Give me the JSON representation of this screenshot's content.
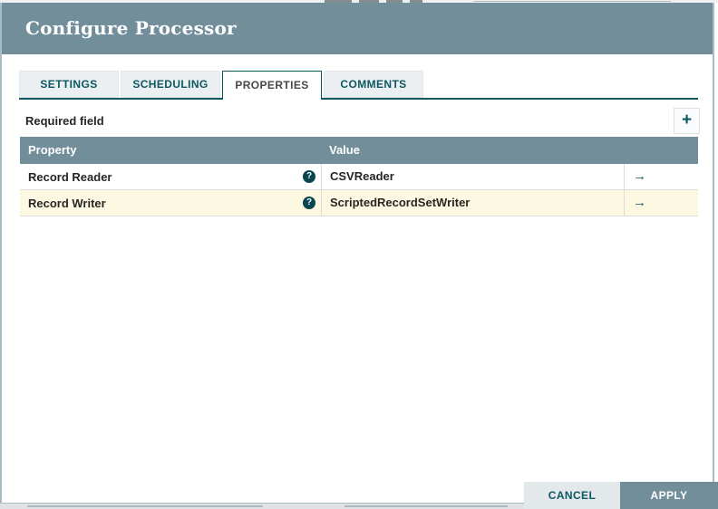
{
  "dialog": {
    "title": "Configure Processor"
  },
  "tabs": [
    {
      "label": "SETTINGS",
      "active": false
    },
    {
      "label": "SCHEDULING",
      "active": false
    },
    {
      "label": "PROPERTIES",
      "active": true
    },
    {
      "label": "COMMENTS",
      "active": false
    }
  ],
  "properties_tab": {
    "required_field_label": "Required field",
    "add_button_icon": "plus-icon",
    "add_button_glyph": "+",
    "table": {
      "columns": {
        "property": "Property",
        "value": "Value"
      },
      "rows": [
        {
          "property": "Record Reader",
          "help_icon": "question-circle-icon",
          "value": "CSVReader",
          "go_icon": "go-to-arrow-icon",
          "highlighted": false
        },
        {
          "property": "Record Writer",
          "help_icon": "question-circle-icon",
          "value": "ScriptedRecordSetWriter",
          "go_icon": "go-to-arrow-icon",
          "highlighted": true
        }
      ]
    }
  },
  "footer": {
    "cancel_label": "CANCEL",
    "apply_label": "APPLY"
  },
  "icons": {
    "help_glyph": "?",
    "go_glyph": "→"
  },
  "colors": {
    "header_bg": "#728E9B",
    "table_header_bg": "#728E9B",
    "accent_teal": "#0b5861",
    "highlighted_row_bg": "#FDF8E1",
    "cancel_button_bg": "#E3E8EA",
    "apply_button_bg": "#728E9B",
    "inactive_tab_bg": "#ECEFF1",
    "body_text": "#262626"
  }
}
